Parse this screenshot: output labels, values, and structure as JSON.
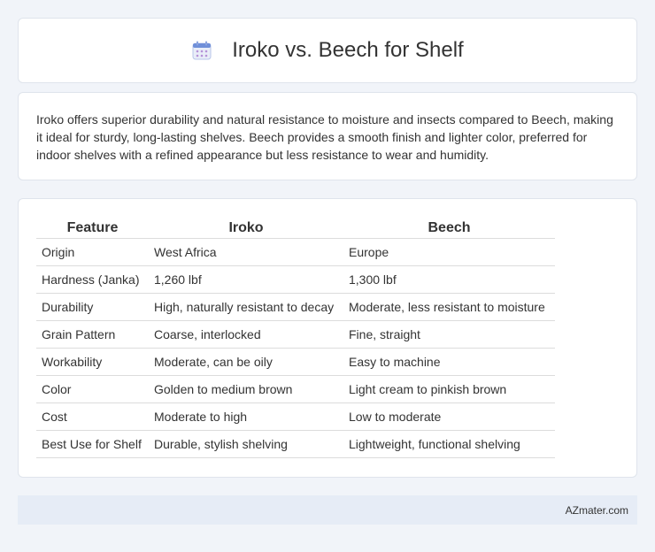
{
  "header": {
    "title": "Iroko vs. Beech for Shelf",
    "icon": "calendar-icon"
  },
  "description": "Iroko offers superior durability and natural resistance to moisture and insects compared to Beech, making it ideal for sturdy, long-lasting shelves. Beech provides a smooth finish and lighter color, preferred for indoor shelves with a refined appearance but less resistance to wear and humidity.",
  "table": {
    "headers": [
      "Feature",
      "Iroko",
      "Beech"
    ],
    "rows": [
      [
        "Origin",
        "West Africa",
        "Europe"
      ],
      [
        "Hardness (Janka)",
        "1,260 lbf",
        "1,300 lbf"
      ],
      [
        "Durability",
        "High, naturally resistant to decay",
        "Moderate, less resistant to moisture"
      ],
      [
        "Grain Pattern",
        "Coarse, interlocked",
        "Fine, straight"
      ],
      [
        "Workability",
        "Moderate, can be oily",
        "Easy to machine"
      ],
      [
        "Color",
        "Golden to medium brown",
        "Light cream to pinkish brown"
      ],
      [
        "Cost",
        "Moderate to high",
        "Low to moderate"
      ],
      [
        "Best Use for Shelf",
        "Durable, stylish shelving",
        "Lightweight, functional shelving"
      ]
    ]
  },
  "footer": {
    "text": "AZmater.com"
  },
  "colors": {
    "background": "#f1f4f9",
    "card": "#ffffff",
    "footer_bg": "#e6ecf6",
    "icon_accent": "#6f8fd9"
  }
}
